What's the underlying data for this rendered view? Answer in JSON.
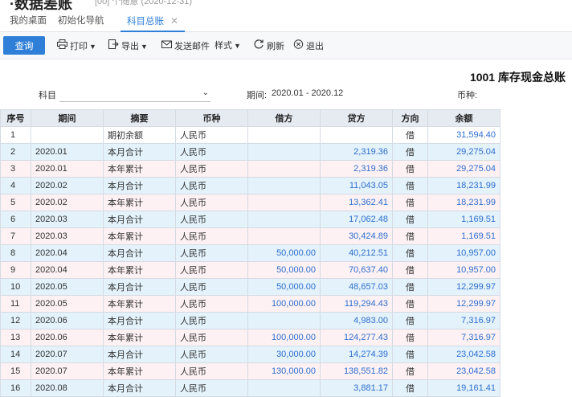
{
  "header": {
    "app_title": "·数据差账",
    "app_meta": "[00] 个随意      (2020-12-31)"
  },
  "tabs": [
    {
      "label": "我的桌面"
    },
    {
      "label": "初始化导航"
    },
    {
      "label": "科目总账",
      "close": "✕"
    }
  ],
  "toolbar": {
    "query": "查询",
    "print": "打印",
    "export": "导出",
    "send_email": "发送邮件",
    "style": "样式",
    "refresh": "刷新",
    "exit": "退出"
  },
  "report_title": "1001 库存现金总账",
  "filters": {
    "subject_label": "科目",
    "subject_value": "",
    "period_label": "期间:",
    "period_value": "2020.01 - 2020.12",
    "currency_label": "币种:"
  },
  "table": {
    "columns": [
      "序号",
      "期间",
      "摘要",
      "币种",
      "借方",
      "贷方",
      "方向",
      "余额"
    ],
    "rows": [
      {
        "seq": "1",
        "period": "",
        "summary": "期初余额",
        "currency": "人民币",
        "debit": "",
        "credit": "",
        "dir": "借",
        "balance": "31,594.40"
      },
      {
        "seq": "2",
        "period": "2020.01",
        "summary": "本月合计",
        "currency": "人民币",
        "debit": "",
        "credit": "2,319.36",
        "dir": "借",
        "balance": "29,275.04"
      },
      {
        "seq": "3",
        "period": "2020.01",
        "summary": "本年累计",
        "currency": "人民币",
        "debit": "",
        "credit": "2,319.36",
        "dir": "借",
        "balance": "29,275.04"
      },
      {
        "seq": "4",
        "period": "2020.02",
        "summary": "本月合计",
        "currency": "人民币",
        "debit": "",
        "credit": "11,043.05",
        "dir": "借",
        "balance": "18,231.99"
      },
      {
        "seq": "5",
        "period": "2020.02",
        "summary": "本年累计",
        "currency": "人民币",
        "debit": "",
        "credit": "13,362.41",
        "dir": "借",
        "balance": "18,231.99"
      },
      {
        "seq": "6",
        "period": "2020.03",
        "summary": "本月合计",
        "currency": "人民币",
        "debit": "",
        "credit": "17,062.48",
        "dir": "借",
        "balance": "1,169.51"
      },
      {
        "seq": "7",
        "period": "2020.03",
        "summary": "本年累计",
        "currency": "人民币",
        "debit": "",
        "credit": "30,424.89",
        "dir": "借",
        "balance": "1,169.51"
      },
      {
        "seq": "8",
        "period": "2020.04",
        "summary": "本月合计",
        "currency": "人民币",
        "debit": "50,000.00",
        "credit": "40,212.51",
        "dir": "借",
        "balance": "10,957.00"
      },
      {
        "seq": "9",
        "period": "2020.04",
        "summary": "本年累计",
        "currency": "人民币",
        "debit": "50,000.00",
        "credit": "70,637.40",
        "dir": "借",
        "balance": "10,957.00"
      },
      {
        "seq": "10",
        "period": "2020.05",
        "summary": "本月合计",
        "currency": "人民币",
        "debit": "50,000.00",
        "credit": "48,657.03",
        "dir": "借",
        "balance": "12,299.97"
      },
      {
        "seq": "11",
        "period": "2020.05",
        "summary": "本年累计",
        "currency": "人民币",
        "debit": "100,000.00",
        "credit": "119,294.43",
        "dir": "借",
        "balance": "12,299.97"
      },
      {
        "seq": "12",
        "period": "2020.06",
        "summary": "本月合计",
        "currency": "人民币",
        "debit": "",
        "credit": "4,983.00",
        "dir": "借",
        "balance": "7,316.97"
      },
      {
        "seq": "13",
        "period": "2020.06",
        "summary": "本年累计",
        "currency": "人民币",
        "debit": "100,000.00",
        "credit": "124,277.43",
        "dir": "借",
        "balance": "7,316.97"
      },
      {
        "seq": "14",
        "period": "2020.07",
        "summary": "本月合计",
        "currency": "人民币",
        "debit": "30,000.00",
        "credit": "14,274.39",
        "dir": "借",
        "balance": "23,042.58"
      },
      {
        "seq": "15",
        "period": "2020.07",
        "summary": "本年累计",
        "currency": "人民币",
        "debit": "130,000.00",
        "credit": "138,551.82",
        "dir": "借",
        "balance": "23,042.58"
      },
      {
        "seq": "16",
        "period": "2020.08",
        "summary": "本月合计",
        "currency": "人民币",
        "debit": "",
        "credit": "3,881.17",
        "dir": "借",
        "balance": "19,161.41"
      }
    ]
  },
  "colors": {
    "accent": "#2f7fd8",
    "row_blue": "#e3f2fb",
    "row_pink": "#fdf1f3",
    "amount_text": "#2f6fd0"
  }
}
